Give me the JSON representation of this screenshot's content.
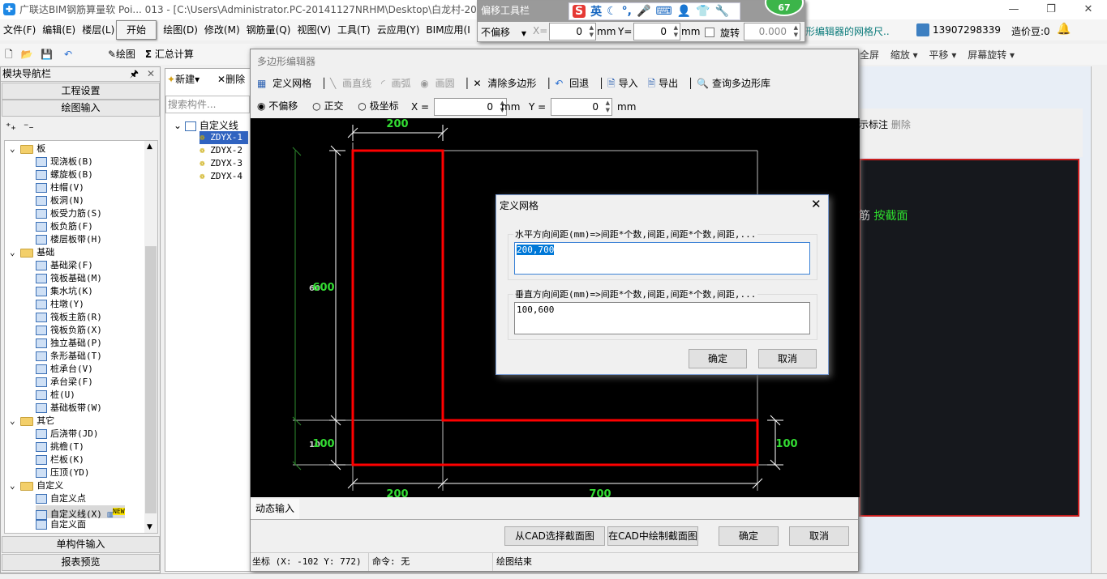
{
  "app": {
    "title": "广联达BIM钢筋算量软 Poi...  013 - [C:\\Users\\Administrator.PC-20141127NRHM\\Desktop\\白龙村-20",
    "minimize": "—",
    "restore": "❐",
    "close": "✕"
  },
  "menu": {
    "items": [
      "文件(F)",
      "编辑(E)",
      "楼层(L)"
    ],
    "start": "开始",
    "items2": [
      "绘图(D)",
      "修改(M)",
      "钢筋量(Q)",
      "视图(V)",
      "工具(T)",
      "云应用(Y)",
      "BIM应用(I"
    ],
    "hint": "形编辑器的网格尺..",
    "account": "13907298339",
    "beans": "造价豆:0"
  },
  "toolbar": {
    "draw": "绘图",
    "sum": "汇总计算",
    "fullscreen": "全屏",
    "zoom": "缩放",
    "pan": "平移",
    "rotate": "屏幕旋转"
  },
  "offset_toolbar": {
    "title": "偏移工具栏",
    "mode": "不偏移",
    "x_label": "X=",
    "x": "0",
    "unit": "mm",
    "y_label": "Y=",
    "y": "0",
    "rotate_label": "旋转",
    "rotate": "0.000",
    "deg": "°",
    "ime_lang": "英",
    "badge": "67"
  },
  "nav": {
    "title": "模块导航栏",
    "project_settings": "工程设置",
    "drawing_input": "绘图输入",
    "single_input": "单构件输入",
    "report_preview": "报表预览",
    "tree": [
      {
        "label": "板",
        "folder": true
      },
      {
        "label": "现浇板(B)"
      },
      {
        "label": "螺旋板(B)"
      },
      {
        "label": "柱帽(V)"
      },
      {
        "label": "板洞(N)"
      },
      {
        "label": "板受力筋(S)"
      },
      {
        "label": "板负筋(F)"
      },
      {
        "label": "楼层板带(H)"
      },
      {
        "label": "基础",
        "folder": true
      },
      {
        "label": "基础梁(F)"
      },
      {
        "label": "筏板基础(M)"
      },
      {
        "label": "集水坑(K)"
      },
      {
        "label": "柱墩(Y)"
      },
      {
        "label": "筏板主筋(R)"
      },
      {
        "label": "筏板负筋(X)"
      },
      {
        "label": "独立基础(P)"
      },
      {
        "label": "条形基础(T)"
      },
      {
        "label": "桩承台(V)"
      },
      {
        "label": "承台梁(F)"
      },
      {
        "label": "桩(U)"
      },
      {
        "label": "基础板带(W)"
      },
      {
        "label": "其它",
        "folder": true
      },
      {
        "label": "后浇带(JD)"
      },
      {
        "label": "挑檐(T)"
      },
      {
        "label": "栏板(K)"
      },
      {
        "label": "压顶(YD)"
      },
      {
        "label": "自定义",
        "folder": true
      },
      {
        "label": "自定义点"
      },
      {
        "label": "自定义线(X)",
        "selected": true,
        "badge": "NEW"
      },
      {
        "label": "自定义面"
      }
    ]
  },
  "components": {
    "new": "新建",
    "delete": "删除",
    "search_placeholder": "搜索构件...",
    "root": "自定义线",
    "items": [
      "ZDYX-1",
      "ZDYX-2",
      "ZDYX-3",
      "ZDYX-4"
    ],
    "selected": "ZDYX-1"
  },
  "editor": {
    "title": "多边形编辑器",
    "tools": {
      "grid": "定义网格",
      "line": "画直线",
      "arc": "画弧",
      "circle": "画圆",
      "clear": "清除多边形",
      "undo": "回退",
      "import": "导入",
      "export": "导出",
      "query": "查询多边形库"
    },
    "offset": {
      "none": "不偏移",
      "ortho": "正交",
      "polar": "极坐标",
      "x_label": "X =",
      "x": "0",
      "y_label": "Y =",
      "y": "0",
      "unit": "mm"
    },
    "dims": {
      "top": "200",
      "left_upper": "600",
      "left_upper_ghost": "60",
      "left_lower": "100",
      "left_lower_ghost": "10",
      "bottom_left": "200",
      "bottom_right": "700",
      "right": "100"
    },
    "dynamic_input": "动态输入",
    "from_cad": "从CAD选择截面图",
    "draw_in_cad": "在CAD中绘制截面图",
    "ok": "确定",
    "cancel": "取消",
    "status": {
      "coords": "坐标 (X: -102 Y: 772)",
      "command": "命令: 无",
      "state": "绘图结束"
    }
  },
  "grid_dialog": {
    "title": "定义网格",
    "h_label": "水平方向间距(mm)=>间距*个数,间距,间距*个数,间距,...",
    "h_value": "200,700",
    "v_label": "垂直方向间距(mm)=>间距*个数,间距,间距*个数,间距,...",
    "v_value": "100,600",
    "ok": "确定",
    "cancel": "取消"
  },
  "behind": {
    "show_dims": "示标注",
    "delete": "删除",
    "rebar": "筋",
    "by_section": "按截面"
  },
  "colors": {
    "polygon": "#ff0000",
    "dimension": "#33dd33",
    "accent": "#0078d7"
  }
}
